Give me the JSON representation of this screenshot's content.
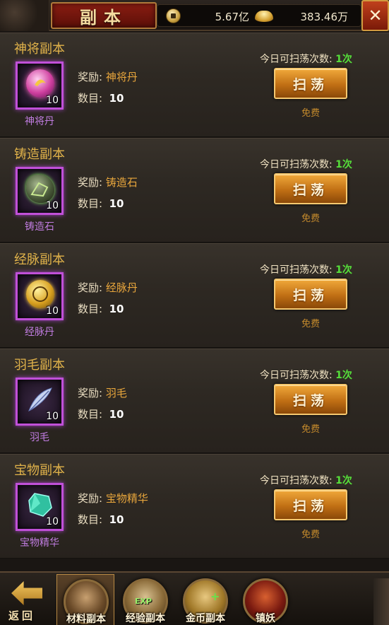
{
  "header": {
    "title": "副本",
    "coins": "5.67亿",
    "ingots": "383.46万",
    "coin_icon": "copper-coin-icon",
    "ingot_icon": "gold-ingot-icon",
    "close_label": "✕"
  },
  "labels": {
    "reward": "奖励:",
    "count": "数目:",
    "sweeps_left": "今日可扫荡次数:",
    "sweep_button": "扫荡",
    "free": "免费"
  },
  "dungeons": [
    {
      "title": "神将副本",
      "reward": "神将丹",
      "count": "10",
      "qty_badge": "10",
      "item_name": "神将丹",
      "sweeps": "1次",
      "icon": "shenjiang-pill-icon"
    },
    {
      "title": "铸造副本",
      "reward": "铸造石",
      "count": "10",
      "qty_badge": "10",
      "item_name": "铸造石",
      "sweeps": "1次",
      "icon": "forge-stone-icon"
    },
    {
      "title": "经脉副本",
      "reward": "经脉丹",
      "count": "10",
      "qty_badge": "10",
      "item_name": "经脉丹",
      "sweeps": "1次",
      "icon": "meridian-pill-icon"
    },
    {
      "title": "羽毛副本",
      "reward": "羽毛",
      "count": "10",
      "qty_badge": "10",
      "item_name": "羽毛",
      "sweeps": "1次",
      "icon": "feather-icon"
    },
    {
      "title": "宝物副本",
      "reward": "宝物精华",
      "count": "10",
      "qty_badge": "10",
      "item_name": "宝物精华",
      "sweeps": "1次",
      "icon": "treasure-essence-icon"
    }
  ],
  "bottom": {
    "back_label": "返回",
    "tabs": [
      {
        "label": "材料副本",
        "active": true,
        "icon": "material-dungeon-icon"
      },
      {
        "label": "经验副本",
        "active": false,
        "icon": "exp-dungeon-icon",
        "badge": "EXP"
      },
      {
        "label": "金币副本",
        "active": false,
        "icon": "gold-dungeon-icon",
        "badge": "+"
      },
      {
        "label": "镇妖",
        "active": false,
        "icon": "demon-seal-icon"
      }
    ]
  },
  "colors": {
    "accent_gold": "#e0b24a",
    "reward_orange": "#e8a63c",
    "item_name_purple": "#c07ce0",
    "sweeps_green": "#56e03a",
    "item_border": "#c050d8"
  }
}
